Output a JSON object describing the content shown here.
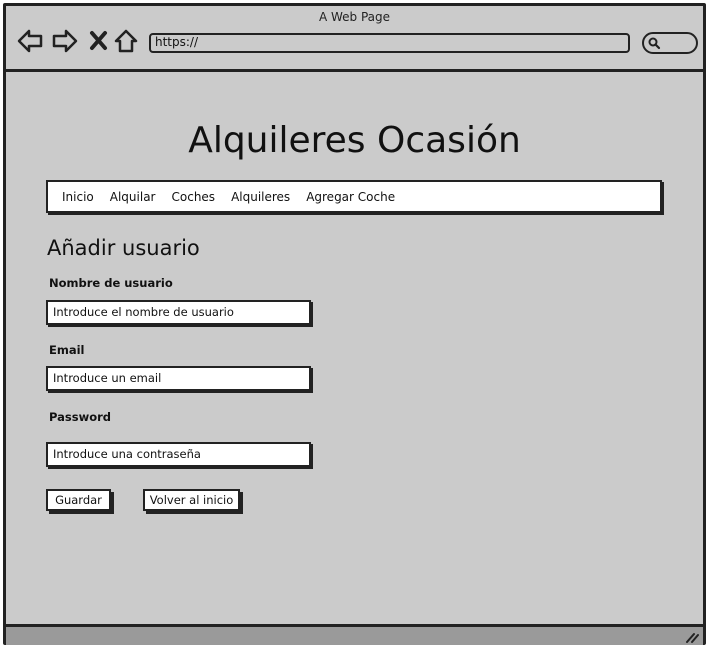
{
  "window": {
    "title": "A Web Page",
    "address": "https://"
  },
  "page": {
    "title": "Alquileres Ocasión",
    "menu": [
      "Inicio",
      "Alquilar",
      "Coches",
      "Alquileres",
      "Agregar Coche"
    ],
    "section_title": "Añadir usuario",
    "form": {
      "username_label": "Nombre de usuario",
      "username_placeholder": "Introduce el nombre de usuario",
      "email_label": "Email",
      "email_placeholder": "Introduce un email",
      "password_label": "Password",
      "password_placeholder": "Introduce una contraseña",
      "save_label": "Guardar",
      "back_label": "Volver al inicio"
    }
  }
}
